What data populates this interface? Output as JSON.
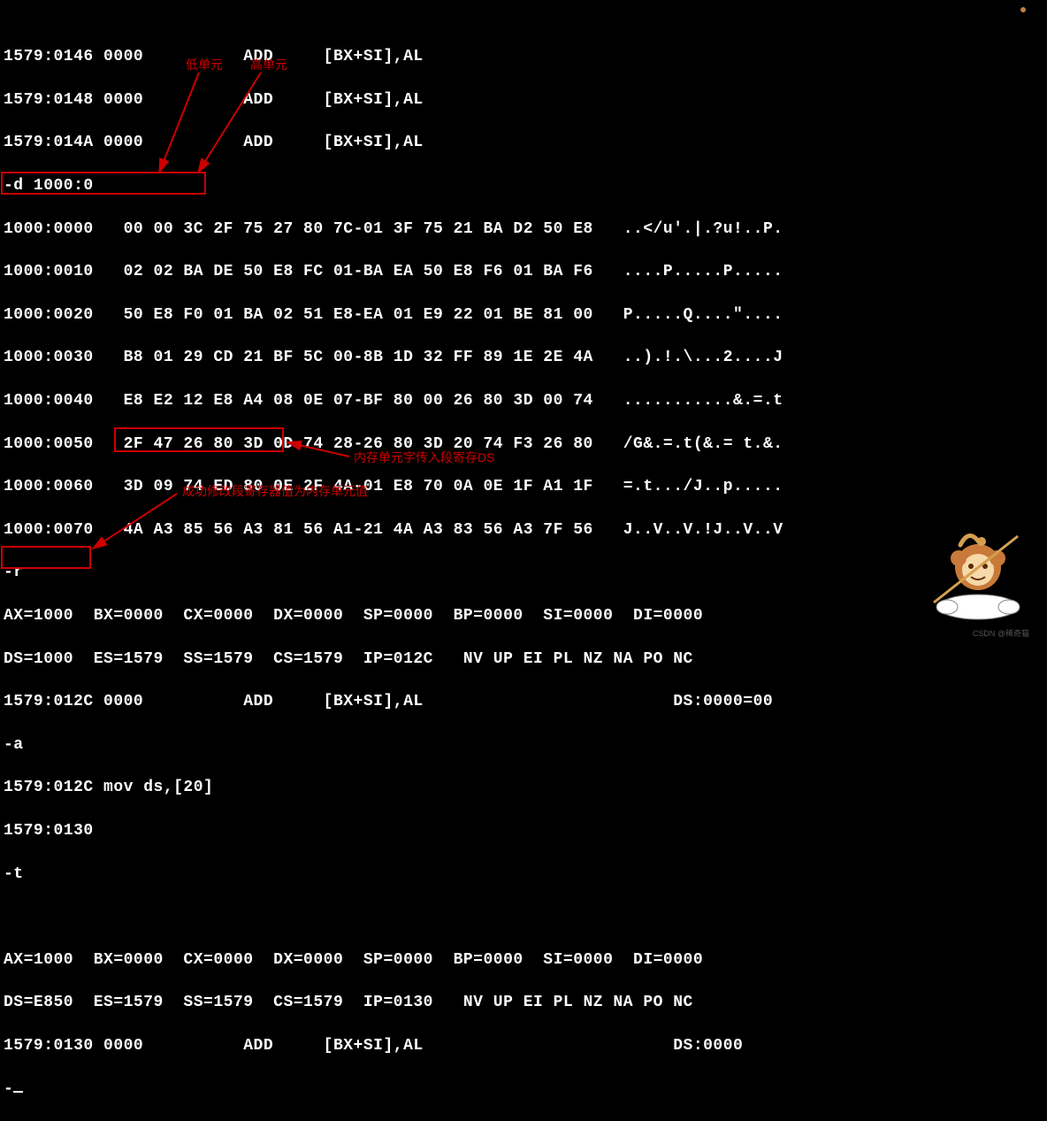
{
  "disasm": [
    "1579:0146 0000          ADD     [BX+SI],AL",
    "1579:0148 0000          ADD     [BX+SI],AL",
    "1579:014A 0000          ADD     [BX+SI],AL"
  ],
  "cmd_d": "-d 1000:0",
  "dump": [
    {
      "addr": "1000:0000",
      "bytes": "00 00 3C 2F 75 27 80 7C-01 3F 75 21 BA D2 50 E8",
      "ascii": "..</u'.|.?u!..P."
    },
    {
      "addr": "1000:0010",
      "bytes": "02 02 BA DE 50 E8 FC 01-BA EA 50 E8 F6 01 BA F6",
      "ascii": "....P.....P....."
    },
    {
      "addr": "1000:0020",
      "bytes": "50 E8 F0 01 BA 02 51 E8-EA 01 E9 22 01 BE 81 00",
      "ascii": "P.....Q....\"...."
    },
    {
      "addr": "1000:0030",
      "bytes": "B8 01 29 CD 21 BF 5C 00-8B 1D 32 FF 89 1E 2E 4A",
      "ascii": "..).!.\\...2....J"
    },
    {
      "addr": "1000:0040",
      "bytes": "E8 E2 12 E8 A4 08 0E 07-BF 80 00 26 80 3D 00 74",
      "ascii": "...........&.=.t"
    },
    {
      "addr": "1000:0050",
      "bytes": "2F 47 26 80 3D 0D 74 28-26 80 3D 20 74 F3 26 80",
      "ascii": "/G&.=.t(&.= t.&."
    },
    {
      "addr": "1000:0060",
      "bytes": "3D 09 74 ED 80 0E 2F 4A-01 E8 70 0A 0E 1F A1 1F",
      "ascii": "=.t.../J..p....."
    },
    {
      "addr": "1000:0070",
      "bytes": "4A A3 85 56 A3 81 56 A1-21 4A A3 83 56 A3 7F 56",
      "ascii": "J..V..V.!J..V..V"
    }
  ],
  "cmd_r": "-r",
  "regs1": {
    "line1": "AX=1000  BX=0000  CX=0000  DX=0000  SP=0000  BP=0000  SI=0000  DI=0000",
    "line2": "DS=1000  ES=1579  SS=1579  CS=1579  IP=012C   NV UP EI PL NZ NA PO NC",
    "line3": "1579:012C 0000          ADD     [BX+SI],AL                         DS:0000=00"
  },
  "cmd_a": "-a",
  "asm1": "1579:012C mov ds,[20]",
  "asm2": "1579:0130",
  "cmd_t": "-t",
  "regs2": {
    "line1": "AX=1000  BX=0000  CX=0000  DX=0000  SP=0000  BP=0000  SI=0000  DI=0000",
    "line2": "DS=E850  ES=1579  SS=1579  CS=1579  IP=0130   NV UP EI PL NZ NA PO NC",
    "line3": "1579:0130 0000          ADD     [BX+SI],AL                         DS:0000"
  },
  "annotations": {
    "low": "低单元",
    "high": "高单元",
    "note1": "内存单元字传入段寄存DS",
    "note2": "成功修改段寄存器值为内存单元值"
  }
}
